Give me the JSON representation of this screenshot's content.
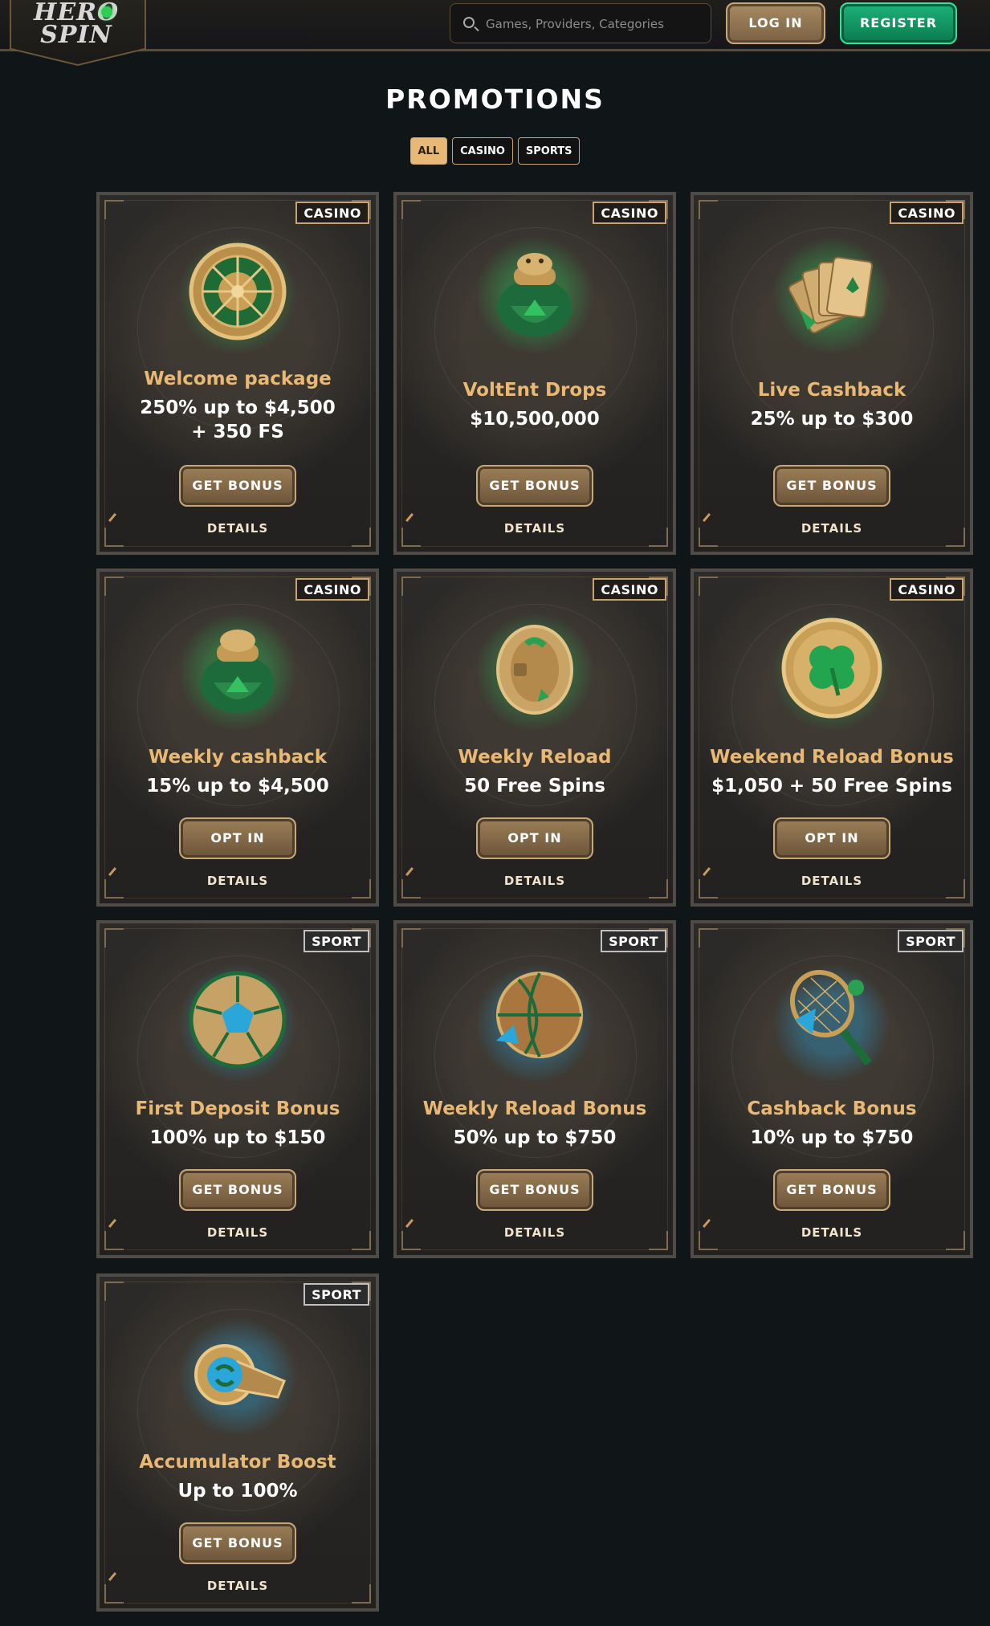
{
  "header": {
    "logo_text": "HERO SPIN",
    "search_placeholder": "Games, Providers, Categories",
    "login_label": "LOG IN",
    "register_label": "REGISTER"
  },
  "page": {
    "title": "PROMOTIONS"
  },
  "filters": [
    {
      "label": "ALL",
      "active": true
    },
    {
      "label": "CASINO",
      "active": false
    },
    {
      "label": "SPORTS",
      "active": false
    }
  ],
  "promotions": [
    {
      "badge": "CASINO",
      "icon": "roulette-wheel-icon",
      "title": "Welcome package",
      "subtitle": "250% up to $4,500 + 350 FS",
      "button": "GET BONUS",
      "details": "DETAILS"
    },
    {
      "badge": "CASINO",
      "icon": "money-bag-icon",
      "title": "VoltEnt Drops",
      "subtitle": "$10,500,000",
      "button": "GET BONUS",
      "details": "DETAILS"
    },
    {
      "badge": "CASINO",
      "icon": "playing-cards-icon",
      "title": "Live Cashback",
      "subtitle": "25% up to $300",
      "button": "GET BONUS",
      "details": "DETAILS"
    },
    {
      "badge": "CASINO",
      "icon": "money-bag-icon",
      "title": "Weekly cashback",
      "subtitle": "15% up to $4,500",
      "button": "OPT IN",
      "details": "DETAILS"
    },
    {
      "badge": "CASINO",
      "icon": "slot-reel-icon",
      "title": "Weekly Reload",
      "subtitle": "50 Free Spins",
      "button": "OPT IN",
      "details": "DETAILS"
    },
    {
      "badge": "CASINO",
      "icon": "clover-coin-icon",
      "title": "Weekend Reload Bonus",
      "subtitle": "$1,050 + 50 Free Spins",
      "button": "OPT IN",
      "details": "DETAILS"
    },
    {
      "badge": "SPORT",
      "icon": "soccer-ball-icon",
      "title": "First Deposit Bonus",
      "subtitle": "100% up to $150",
      "button": "GET BONUS",
      "details": "DETAILS"
    },
    {
      "badge": "SPORT",
      "icon": "basketball-icon",
      "title": "Weekly Reload Bonus",
      "subtitle": "50% up to $750",
      "button": "GET BONUS",
      "details": "DETAILS"
    },
    {
      "badge": "SPORT",
      "icon": "tennis-racket-icon",
      "title": "Cashback Bonus",
      "subtitle": "10% up to $750",
      "button": "GET BONUS",
      "details": "DETAILS"
    },
    {
      "badge": "SPORT",
      "icon": "whistle-icon",
      "title": "Accumulator Boost",
      "subtitle": "Up to 100%",
      "button": "GET BONUS",
      "details": "DETAILS"
    }
  ],
  "colors": {
    "background": "#101517",
    "accent_gold": "#e9b874",
    "register_green": "#1eb27a"
  }
}
